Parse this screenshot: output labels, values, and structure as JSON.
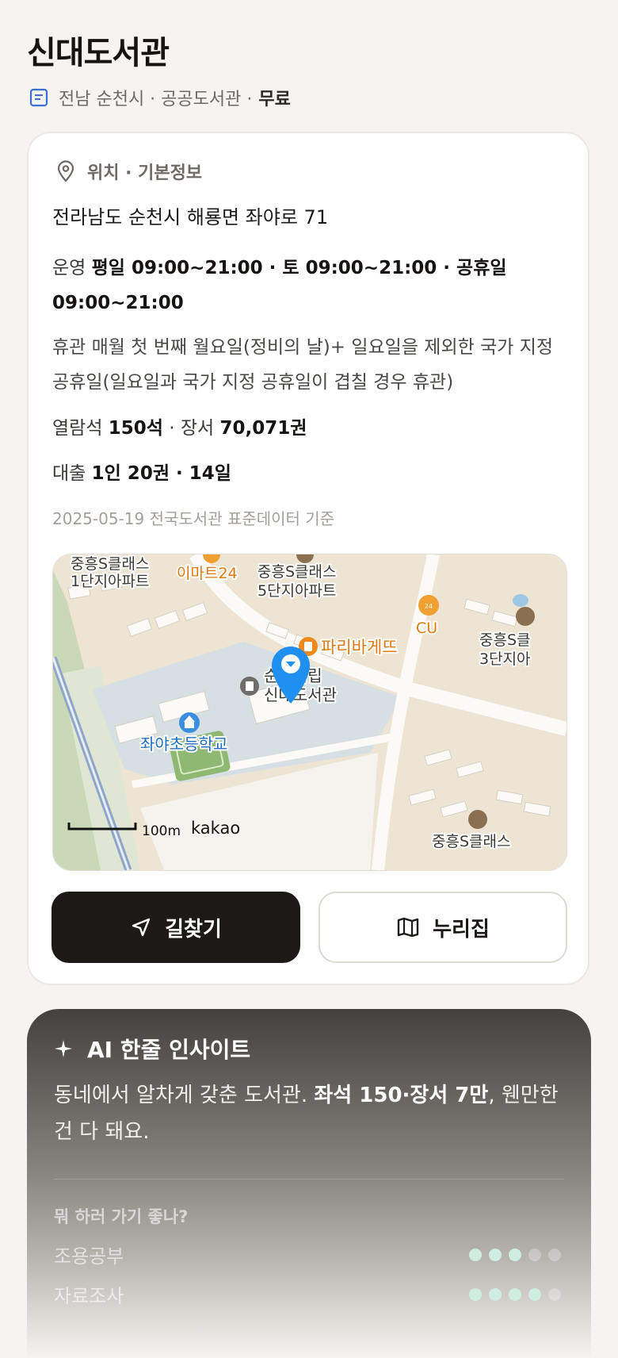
{
  "header": {
    "title": "신대도서관",
    "meta_text": "전남 순천시 · 공공도서관 · ",
    "meta_price": "무료",
    "meta_icon": "document-icon"
  },
  "info": {
    "section_title": "위치 · 기본정보",
    "address": "전라남도 순천시 해룡면 좌야로 71",
    "hours_label": "운영 ",
    "hours_value": "평일 09:00~21:00 · 토 09:00~21:00 · 공휴일 09:00~21:00",
    "closed_label": "휴관 ",
    "closed_value": "매월 첫 번째 월요일(정비의 날)+ 일요일을 제외한 국가 지정 공휴일(일요일과 국가 지정 공휴일이 겹칠 경우 휴관)",
    "seats_label": "열람석 ",
    "seats_value": "150석",
    "books_label": " · 장서 ",
    "books_value": "70,071권",
    "loan_label": "대출 ",
    "loan_value": "1인 20권 · 14일",
    "source": "2025-05-19 전국도서관 표준데이터 기준"
  },
  "map": {
    "labels": {
      "apt1": "중흥S클래스",
      "apt1b": "1단지아파트",
      "emart": "이마트24",
      "apt5": "중흥S클래스",
      "apt5b": "5단지아파트",
      "bakery": "파리바게뜨",
      "cu": "CU",
      "apt3": "중흥S클",
      "apt3b": "3단지아",
      "library": "순천시립",
      "libraryb": "신대도서관",
      "school": "좌야초등학교",
      "apt_bottom": "중흥S클래스",
      "scale": "100m",
      "brand": "kakao"
    }
  },
  "buttons": {
    "directions": "길찾기",
    "nurijip": "누리집"
  },
  "ai": {
    "title": "AI 한줄 인사이트",
    "text_plain": "동네에서 알차게 갖춘 도서관. ",
    "text_bold": "좌석 150·장서 7만",
    "text_end": ", 웬만한 건 다 돼요.",
    "question": "뭐 하러 가기 좋나?",
    "rows": [
      {
        "label": "조용공부",
        "rating": 3,
        "max": 5
      },
      {
        "label": "자료조사",
        "rating": 4,
        "max": 5
      }
    ]
  },
  "colors": {
    "accent_dark": "#1b1a17",
    "pin_blue": "#1f8ff0",
    "map_bg": "#f1ece2",
    "dot_active": "#cfeee0"
  }
}
